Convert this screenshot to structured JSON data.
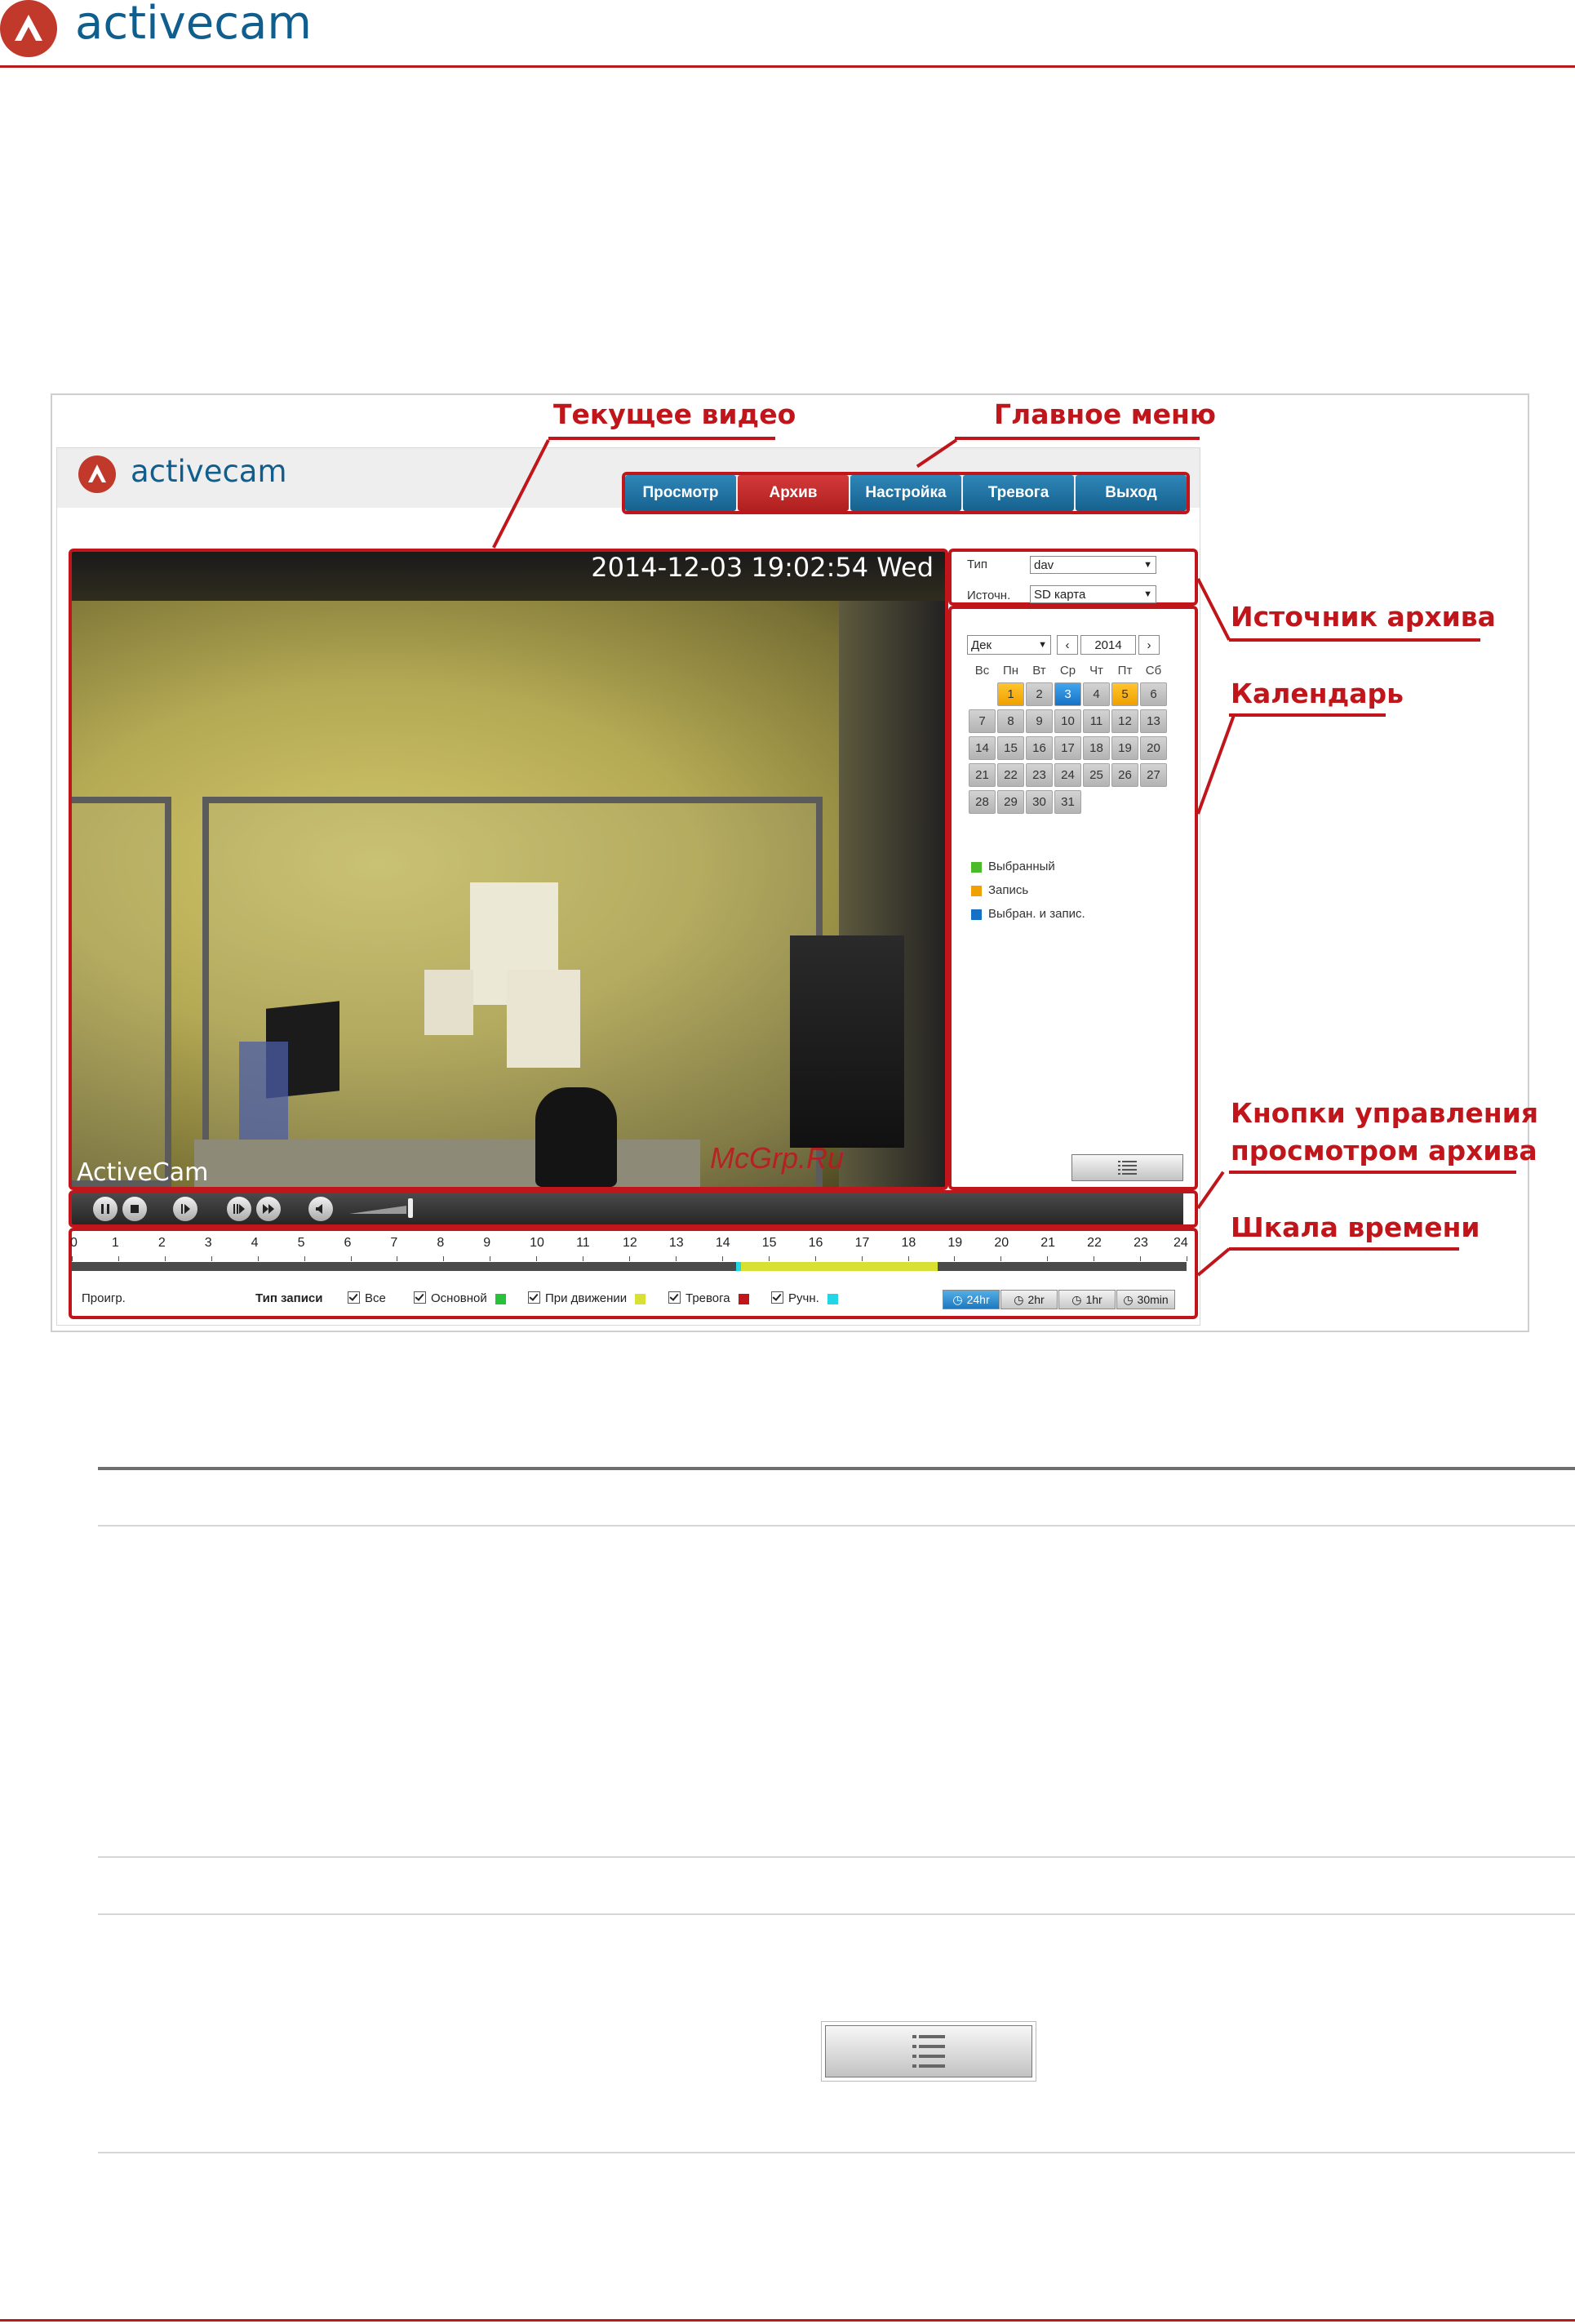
{
  "page_header": {
    "brand": "activecam"
  },
  "ui": {
    "brand": "activecam",
    "nav": [
      {
        "label": "Просмотр",
        "active": false
      },
      {
        "label": "Архив",
        "active": true
      },
      {
        "label": "Настройка",
        "active": false
      },
      {
        "label": "Тревога",
        "active": false
      },
      {
        "label": "Выход",
        "active": false
      }
    ],
    "video": {
      "timestamp": "2014-12-03 19:02:54 Wed",
      "osd": "ActiveCam",
      "watermark": "McGrp.Ru"
    },
    "source": {
      "type_label": "Тип",
      "type_value": "dav",
      "source_label": "Источн.",
      "source_value": "SD карта"
    },
    "calendar": {
      "month": "Дек",
      "year": "2014",
      "weekdays": [
        "Вс",
        "Пн",
        "Вт",
        "Ср",
        "Чт",
        "Пт",
        "Сб"
      ],
      "recorded_days": [
        1,
        5
      ],
      "selected_recorded_day": 3,
      "days_in_month": 31,
      "first_weekday": 1,
      "legend": [
        {
          "label": "Выбранный",
          "color": "#4cbb2b"
        },
        {
          "label": "Запись",
          "color": "#f0a000"
        },
        {
          "label": "Выбран. и запис.",
          "color": "#1671c6"
        }
      ]
    },
    "timeline": {
      "ticks": [
        "0",
        "1",
        "2",
        "3",
        "4",
        "5",
        "6",
        "7",
        "8",
        "9",
        "10",
        "11",
        "12",
        "13",
        "14",
        "15",
        "16",
        "17",
        "18",
        "19",
        "20",
        "21",
        "22",
        "23",
        "24"
      ],
      "play_label": "Проигр.",
      "record_type_label": "Тип записи",
      "filters": [
        {
          "label": "Все",
          "color": ""
        },
        {
          "label": "Основной",
          "color": "#27c23a"
        },
        {
          "label": "При движении",
          "color": "#d8e033"
        },
        {
          "label": "Тревога",
          "color": "#c0161b"
        },
        {
          "label": "Ручн.",
          "color": "#22d6e6"
        }
      ],
      "zoom": [
        "24hr",
        "2hr",
        "1hr",
        "30min"
      ],
      "active_zoom": "24hr",
      "motion_segment_hours": [
        14.35,
        18.65
      ],
      "manual_segment_hours": [
        14.3,
        14.4
      ]
    }
  },
  "callouts": {
    "current_video": "Текущее видео",
    "main_menu": "Главное меню",
    "archive_source": "Источник архива",
    "calendar": "Календарь",
    "playback_controls_1": "Кнопки управления",
    "playback_controls_2": "просмотром архива",
    "timeline": "Шкала времени"
  }
}
